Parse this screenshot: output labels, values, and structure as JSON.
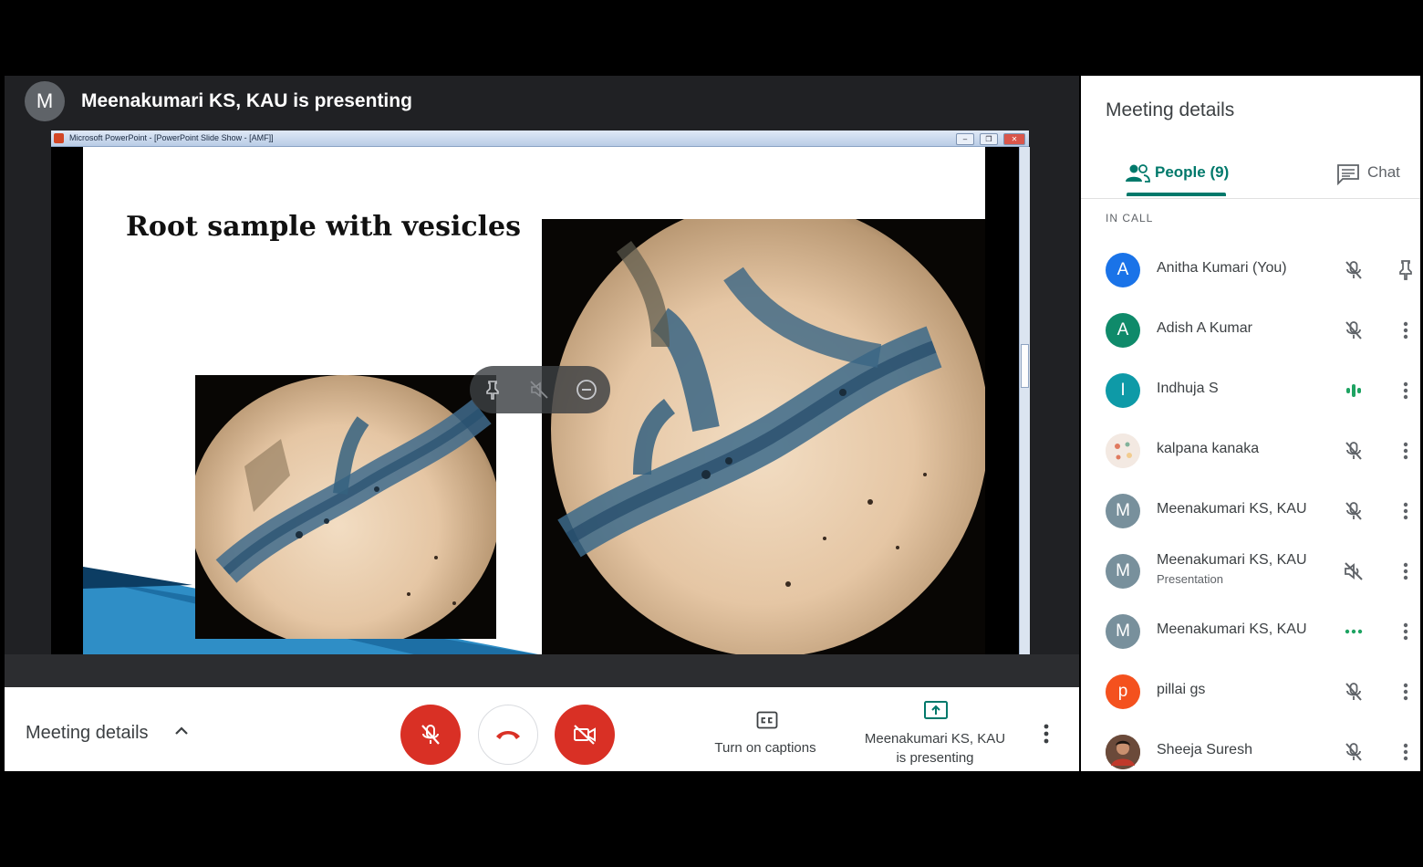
{
  "stage": {
    "presenter_initial": "M",
    "presenter_text": "Meenakumari KS, KAU is presenting"
  },
  "ppt": {
    "window_title": "Microsoft PowerPoint - [PowerPoint Slide Show - [AMF]]",
    "slide_title": "Root sample with vesicles"
  },
  "bottombar": {
    "meeting_details": "Meeting details",
    "captions_label": "Turn on captions",
    "presenting_line1": "Meenakumari KS, KAU",
    "presenting_line2": "is presenting"
  },
  "panel": {
    "title": "Meeting details",
    "tab_people": "People (9)",
    "tab_chat": "Chat",
    "section_label": "IN CALL",
    "people": [
      {
        "initial": "A",
        "name": "Anitha Kumari (You)",
        "sub": "",
        "color": "#1a73e8",
        "status": "muted",
        "action": "pin"
      },
      {
        "initial": "A",
        "name": "Adish A Kumar",
        "sub": "",
        "color": "#0f8a6a",
        "status": "muted",
        "action": "more"
      },
      {
        "initial": "I",
        "name": "Indhuja S",
        "sub": "",
        "color": "#0e9aa7",
        "status": "speaking",
        "action": "more"
      },
      {
        "initial": "",
        "name": "kalpana kanaka",
        "sub": "",
        "color": "#f3e9e2",
        "status": "muted",
        "action": "more"
      },
      {
        "initial": "M",
        "name": "Meenakumari KS, KAU",
        "sub": "",
        "color": "#78909c",
        "status": "muted",
        "action": "more"
      },
      {
        "initial": "M",
        "name": "Meenakumari KS, KAU",
        "sub": "Presentation",
        "color": "#78909c",
        "status": "audio-off",
        "action": "more"
      },
      {
        "initial": "M",
        "name": "Meenakumari KS, KAU",
        "sub": "",
        "color": "#78909c",
        "status": "idle",
        "action": "more"
      },
      {
        "initial": "p",
        "name": "pillai gs",
        "sub": "",
        "color": "#f4511e",
        "status": "muted",
        "action": "more"
      },
      {
        "initial": "",
        "name": "Sheeja Suresh",
        "sub": "",
        "color": "#5a3a2a",
        "status": "muted",
        "action": "more"
      }
    ]
  },
  "colors": {
    "accent": "#00796b",
    "danger": "#d93025",
    "stage_bg": "#202124"
  }
}
